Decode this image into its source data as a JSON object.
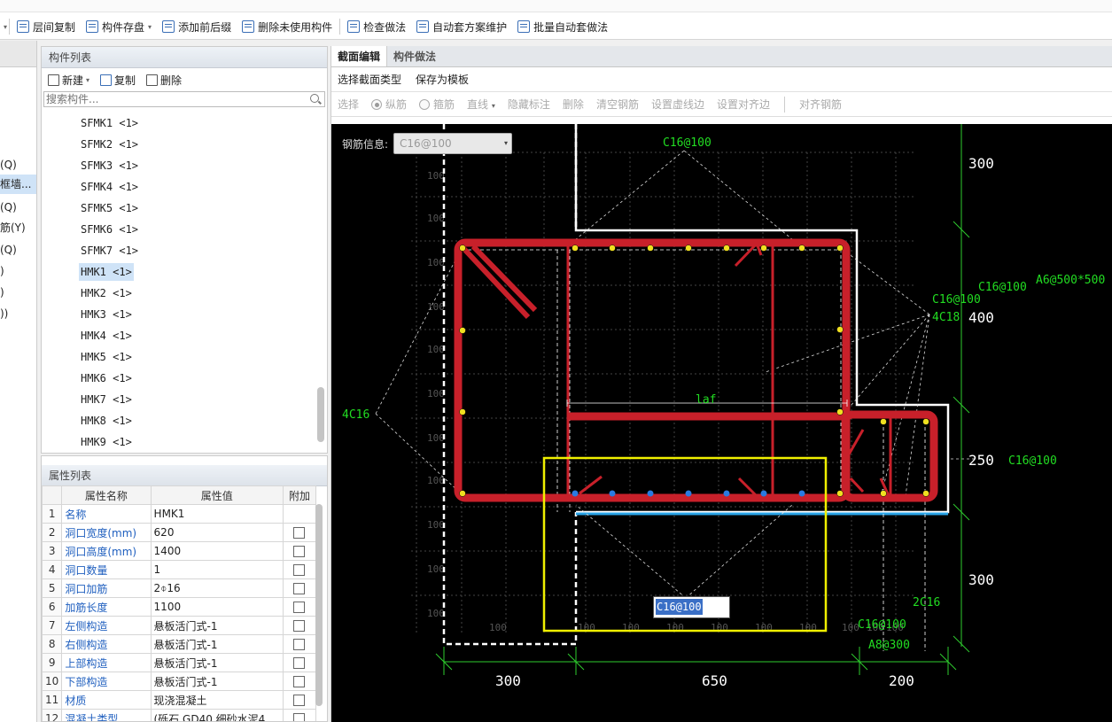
{
  "toolbar": {
    "items": [
      {
        "label": "层间复制",
        "icon": "copy-floor-icon"
      },
      {
        "label": "构件存盘",
        "icon": "save-component-icon"
      },
      {
        "label": "添加前后缀",
        "icon": "prefix-suffix-icon"
      },
      {
        "label": "删除未使用构件",
        "icon": "delete-unused-icon"
      },
      {
        "label": "检查做法",
        "icon": "check-method-icon"
      },
      {
        "label": "自动套方案维护",
        "icon": "auto-scheme-icon"
      },
      {
        "label": "批量自动套做法",
        "icon": "batch-auto-icon"
      }
    ]
  },
  "left_strip": {
    "items": [
      "(Q)",
      "框墙...",
      "(Q)",
      "筋(Y)",
      "(Q)",
      ")",
      ")",
      "))"
    ]
  },
  "component_list": {
    "title": "构件列表",
    "new_label": "新建",
    "copy_label": "复制",
    "delete_label": "删除",
    "search_placeholder": "搜索构件...",
    "items": [
      "SFMK1 <1>",
      "SFMK2 <1>",
      "SFMK3 <1>",
      "SFMK4 <1>",
      "SFMK5 <1>",
      "SFMK6 <1>",
      "SFMK7 <1>",
      "HMK1 <1>",
      "HMK2 <1>",
      "HMK3 <1>",
      "HMK4 <1>",
      "HMK5 <1>",
      "HMK6 <1>",
      "HMK7 <1>",
      "HMK8 <1>",
      "HMK9 <1>"
    ],
    "selected": "HMK1 <1>"
  },
  "properties": {
    "title": "属性列表",
    "headers": [
      "属性名称",
      "属性值",
      "附加"
    ],
    "rows": [
      {
        "no": "1",
        "name": "名称",
        "value": "HMK1",
        "check": false
      },
      {
        "no": "2",
        "name": "洞口宽度(mm)",
        "value": "620",
        "check": true
      },
      {
        "no": "3",
        "name": "洞口高度(mm)",
        "value": "1400",
        "check": true
      },
      {
        "no": "4",
        "name": "洞口数量",
        "value": "1",
        "check": true
      },
      {
        "no": "5",
        "name": "洞口加筋",
        "value": "2⌽16",
        "check": true
      },
      {
        "no": "6",
        "name": "加筋长度",
        "value": "1100",
        "check": true
      },
      {
        "no": "7",
        "name": "左侧构造",
        "value": "悬板活门式-1",
        "check": true
      },
      {
        "no": "8",
        "name": "右侧构造",
        "value": "悬板活门式-1",
        "check": true
      },
      {
        "no": "9",
        "name": "上部构造",
        "value": "悬板活门式-1",
        "check": true
      },
      {
        "no": "10",
        "name": "下部构造",
        "value": "悬板活门式-1",
        "check": true
      },
      {
        "no": "11",
        "name": "材质",
        "value": "现浇混凝土",
        "check": true
      },
      {
        "no": "12",
        "name": "混凝土类型",
        "value": "(砾石 GD40 细砂水泥4...",
        "check": true
      }
    ]
  },
  "editor": {
    "tabs": [
      "截面编辑",
      "构件做法"
    ],
    "active_tab": "截面编辑",
    "toolbar1": [
      "选择截面类型",
      "保存为模板"
    ],
    "toolbar2": {
      "select": "选择",
      "radio1": "纵筋",
      "radio2": "箍筋",
      "line": "直线",
      "hide_label": "隐藏标注",
      "delete": "删除",
      "clear": "清空钢筋",
      "set_dash": "设置虚线边",
      "set_align": "设置对齐边",
      "align_rebar": "对齐钢筋"
    },
    "rebar_info_label": "钢筋信息:",
    "rebar_info_value": "C16@100",
    "edit_value": "C16@100"
  },
  "drawing": {
    "labels": {
      "top": "C16@100",
      "right_mid1": "C16@100",
      "right_mid2": "4C18",
      "right_far1": "C16@100",
      "right_far2": "A6@500*500",
      "left": "4C16",
      "laf": "laf",
      "right_250": "C16@100",
      "bottom_right1": "2C16",
      "bottom_right2": "C16@100",
      "bottom_right3": "A8@300"
    },
    "dims_right": [
      "300",
      "400",
      "250",
      "300"
    ],
    "dims_bottom": [
      "300",
      "650",
      "200"
    ],
    "grid_labels": [
      "100",
      "100",
      "100",
      "100",
      "100",
      "100",
      "100",
      "100",
      "100",
      "100",
      "100"
    ],
    "bottom_grid": [
      "100",
      "100",
      "100",
      "100",
      "100",
      "100",
      "100",
      "100",
      "100",
      "100"
    ]
  },
  "colors": {
    "accent": "#3a6fc6",
    "rebar": "#cc1f2a",
    "green_text": "#22dd22",
    "yellow_box": "#f0f000",
    "canvas_bg": "#000000"
  }
}
